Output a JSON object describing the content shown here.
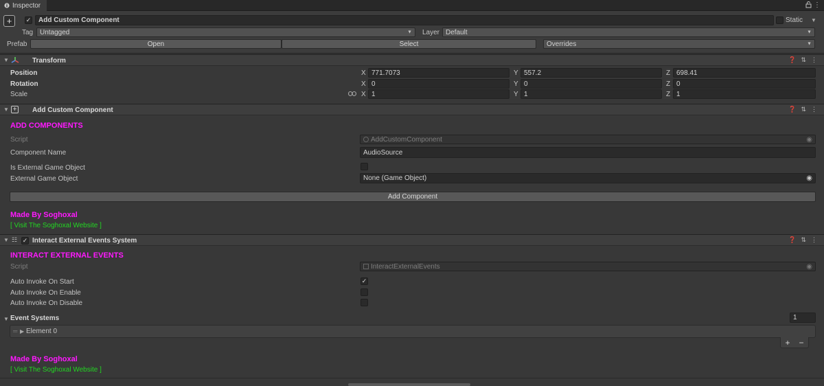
{
  "window": {
    "tab_label": "Inspector",
    "tab_icon": "info-icon"
  },
  "header": {
    "add_icon_glyph": "+",
    "active_check": "✓",
    "object_name": "Add Custom Component",
    "static_label": "Static",
    "tag_label": "Tag",
    "tag_value": "Untagged",
    "layer_label": "Layer",
    "layer_value": "Default",
    "prefab_label": "Prefab",
    "open_label": "Open",
    "select_label": "Select",
    "overrides_label": "Overrides"
  },
  "transform": {
    "title": "Transform",
    "rows": [
      {
        "label": "Position",
        "x": "771.7073",
        "y": "557.2",
        "z": "698.41"
      },
      {
        "label": "Rotation",
        "x": "0",
        "y": "0",
        "z": "0"
      },
      {
        "label": "Scale",
        "x": "1",
        "y": "1",
        "z": "1"
      }
    ],
    "axis_x": "X",
    "axis_y": "Y",
    "axis_z": "Z"
  },
  "add_custom": {
    "title": "Add Custom Component",
    "heading": "ADD COMPONENTS",
    "script_label": "Script",
    "script_value": "AddCustomComponent",
    "component_name_label": "Component Name",
    "component_name_value": "AudioSource",
    "is_external_label": "Is External Game Object",
    "external_label": "External Game Object",
    "external_value": "None (Game Object)",
    "button_label": "Add Component",
    "made_by": "Made By Soghoxal",
    "visit": "[ Visit The Soghoxal Website ]"
  },
  "interact": {
    "title": "Interact External Events System",
    "heading": "INTERACT EXTERNAL EVENTS",
    "script_label": "Script",
    "script_value": "InteractExternalEvents",
    "start_label": "Auto Invoke On Start",
    "start_check": "✓",
    "enable_label": "Auto Invoke On Enable",
    "disable_label": "Auto Invoke On Disable",
    "event_systems_label": "Event Systems",
    "event_count": "1",
    "element_label": "Element 0",
    "plus": "+",
    "minus": "−",
    "made_by": "Made By Soghoxal",
    "visit": "[ Visit The Soghoxal Website ]"
  },
  "colors": {
    "magenta": "#ff19ff",
    "green": "#22d622",
    "panel": "#383838"
  }
}
